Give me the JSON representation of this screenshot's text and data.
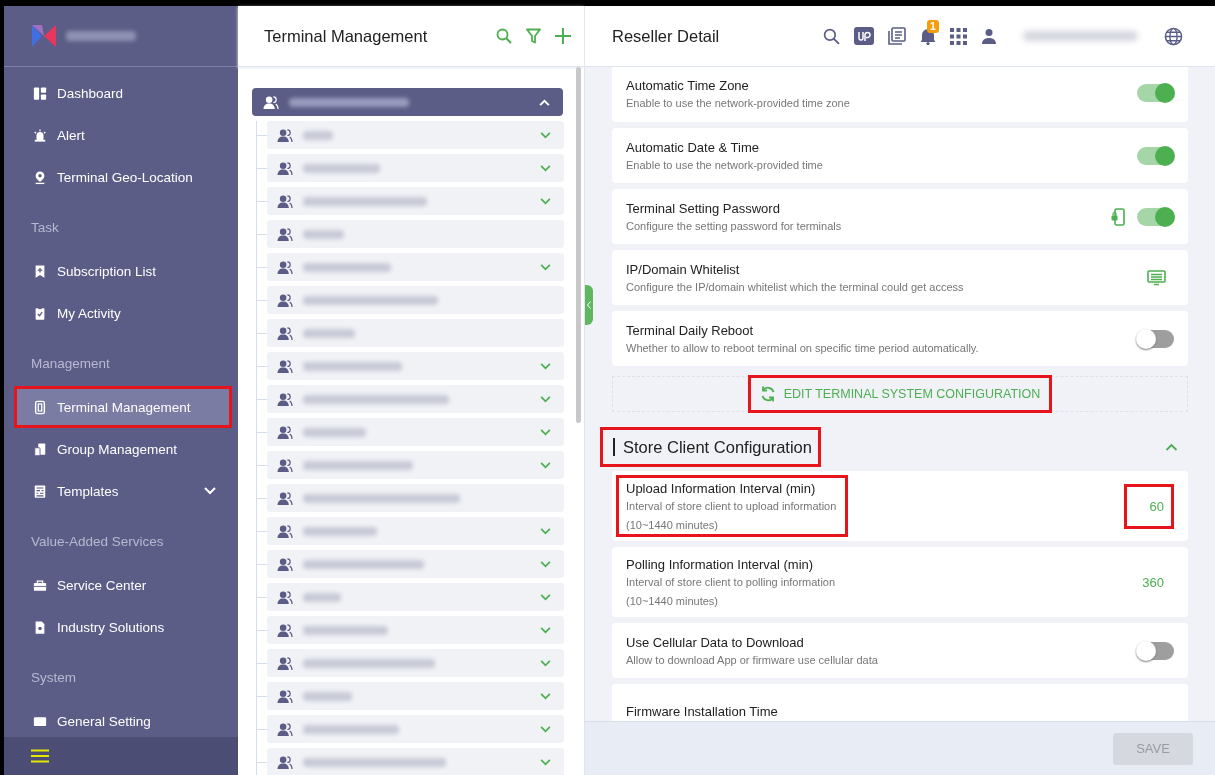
{
  "sidebar": {
    "items": [
      {
        "kind": "item",
        "label": "Dashboard",
        "selected": false,
        "highlighted": false
      },
      {
        "kind": "item",
        "label": "Alert",
        "selected": false,
        "highlighted": false
      },
      {
        "kind": "item",
        "label": "Terminal Geo-Location",
        "selected": false,
        "highlighted": false
      },
      {
        "kind": "header",
        "label": "Task"
      },
      {
        "kind": "item",
        "label": "Subscription List",
        "selected": false,
        "highlighted": false
      },
      {
        "kind": "item",
        "label": "My Activity",
        "selected": false,
        "highlighted": false
      },
      {
        "kind": "header",
        "label": "Management"
      },
      {
        "kind": "item",
        "label": "Terminal Management",
        "selected": true,
        "highlighted": true
      },
      {
        "kind": "item",
        "label": "Group Management",
        "selected": false,
        "highlighted": false
      },
      {
        "kind": "item",
        "label": "Templates",
        "selected": false,
        "highlighted": false,
        "expanded": false
      },
      {
        "kind": "header",
        "label": "Value-Added Services"
      },
      {
        "kind": "item",
        "label": "Service Center",
        "selected": false,
        "highlighted": false
      },
      {
        "kind": "item",
        "label": "Industry Solutions",
        "selected": false,
        "highlighted": false
      },
      {
        "kind": "header",
        "label": "System"
      },
      {
        "kind": "item",
        "label": "General Setting",
        "selected": false,
        "highlighted": false
      }
    ]
  },
  "terminal_panel": {
    "title": "Terminal Management",
    "tree": {
      "root": {
        "selected": true,
        "expanded": true,
        "children": [
          {
            "leaf": false
          },
          {
            "leaf": false
          },
          {
            "leaf": false
          },
          {
            "leaf": true
          },
          {
            "leaf": false
          },
          {
            "leaf": true
          },
          {
            "leaf": true
          },
          {
            "leaf": false
          },
          {
            "leaf": false
          },
          {
            "leaf": false
          },
          {
            "leaf": false
          },
          {
            "leaf": true
          },
          {
            "leaf": false
          },
          {
            "leaf": false
          },
          {
            "leaf": false
          },
          {
            "leaf": false
          },
          {
            "leaf": false
          },
          {
            "leaf": false
          },
          {
            "leaf": false
          },
          {
            "leaf": false
          }
        ]
      }
    }
  },
  "detail_panel": {
    "title": "Reseller Detail",
    "notification_count": "1",
    "settings": [
      {
        "kind": "toggle",
        "title": "Automatic Time Zone",
        "description": "Enable to use the network-provided time zone",
        "on": true
      },
      {
        "kind": "toggle",
        "title": "Automatic Date & Time",
        "description": "Enable to use the network-provided time",
        "on": true
      },
      {
        "kind": "locked-toggle",
        "title": "Terminal Setting Password",
        "description": "Configure the setting password for terminals",
        "on": true
      },
      {
        "kind": "list",
        "title": "IP/Domain Whitelist",
        "description": "Configure the IP/domain whitelist which the terminal could get access"
      },
      {
        "kind": "toggle",
        "title": "Terminal Daily Reboot",
        "description": "Whether to allow to reboot terminal on specific time period automatically.",
        "on": false
      }
    ],
    "edit_button": {
      "label": "EDIT TERMINAL SYSTEM CONFIGURATION",
      "highlighted": true
    },
    "section": {
      "title": "Store Client Configuration",
      "expanded": true,
      "highlighted": true,
      "settings": [
        {
          "kind": "value",
          "title": "Upload Information Interval (min)",
          "description": "Interval of store client to upload information",
          "range": "(10~1440 minutes)",
          "value": "60",
          "highlighted": true
        },
        {
          "kind": "value",
          "title": "Polling Information Interval (min)",
          "description": "Interval of store client to polling information",
          "range": "(10~1440 minutes)",
          "value": "360",
          "highlighted": false
        },
        {
          "kind": "toggle",
          "title": "Use Cellular Data to Download",
          "description": "Allow to download App or firmware use cellular data",
          "on": false
        },
        {
          "kind": "plain",
          "title": "Firmware Installation Time"
        }
      ]
    },
    "save_button": {
      "label": "SAVE",
      "disabled": true
    }
  }
}
